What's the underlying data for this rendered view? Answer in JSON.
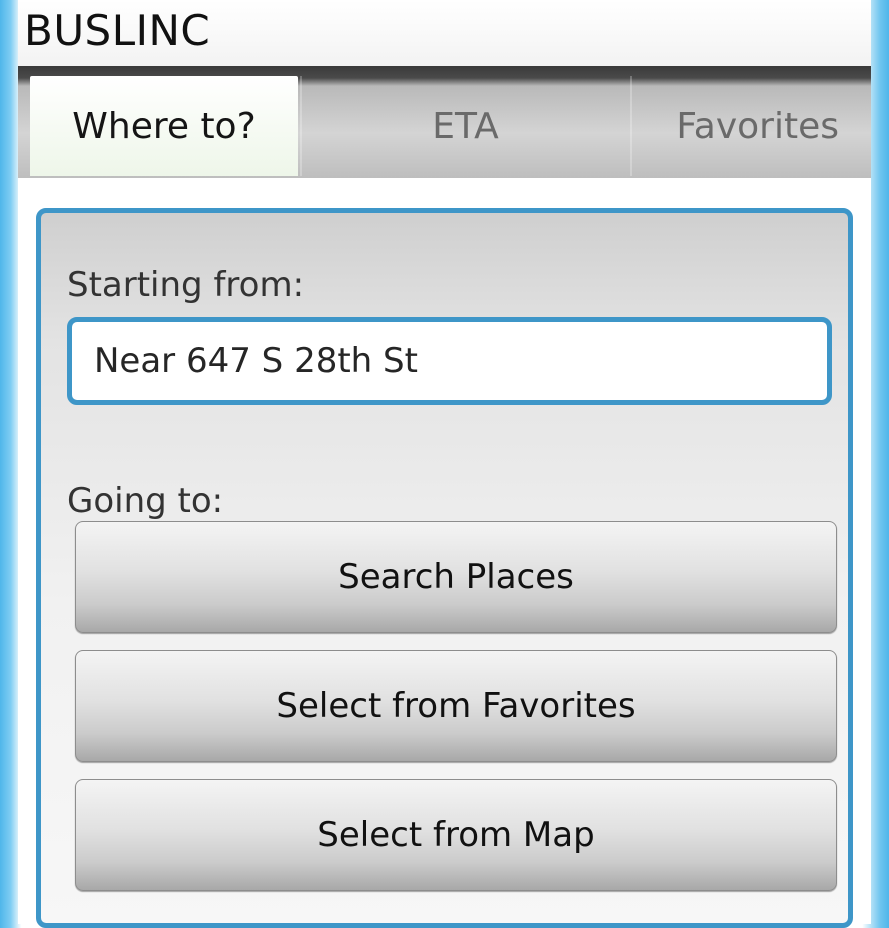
{
  "app": {
    "title": "BUSLINC"
  },
  "tabs": [
    {
      "label": "Where to?",
      "active": true
    },
    {
      "label": "ETA",
      "active": false
    },
    {
      "label": "Favorites",
      "active": false
    }
  ],
  "form": {
    "starting_label": "Starting from:",
    "starting_value": "Near 647 S 28th St",
    "going_label": "Going to:",
    "buttons": [
      {
        "label": "Search Places"
      },
      {
        "label": "Select from Favorites"
      },
      {
        "label": "Select from Map"
      }
    ]
  },
  "colors": {
    "accent": "#3e96c8",
    "active_tab": "#eef6e9"
  }
}
